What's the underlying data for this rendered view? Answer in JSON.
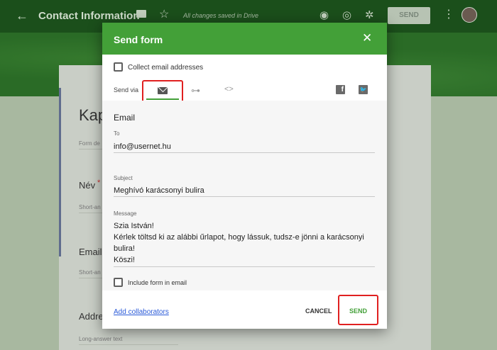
{
  "app": {
    "title": "Contact Information",
    "save_status": "All changes saved in Drive",
    "send_button": "SEND"
  },
  "background_form": {
    "title_fragment": "Kap",
    "desc_fragment": "Form de",
    "questions": [
      {
        "label": "Név",
        "required": "*",
        "hint": "Short-an"
      },
      {
        "label": "Email",
        "hint": "Short-an"
      },
      {
        "label": "Addre",
        "hint": "Long-answer text"
      }
    ]
  },
  "dialog": {
    "title": "Send form",
    "collect_email_label": "Collect email addresses",
    "send_via_label": "Send via",
    "active_tab": "email",
    "email_section_title": "Email",
    "to_label": "To",
    "to_value": "info@usernet.hu",
    "subject_label": "Subject",
    "subject_value": "Meghívó karácsonyi bulira",
    "message_label": "Message",
    "message_lines": [
      "Szia István!",
      "Kérlek töltsd ki az alábbi űrlapot, hogy lássuk, tudsz-e jönni a karácsonyi",
      "bulira!",
      "Köszi!"
    ],
    "include_form_label": "Include form in email",
    "add_collaborators": "Add collaborators",
    "cancel": "CANCEL",
    "send": "SEND"
  },
  "colors": {
    "header_green": "#43a038",
    "highlight_red": "#e02020",
    "link_blue": "#2a5ad8"
  }
}
